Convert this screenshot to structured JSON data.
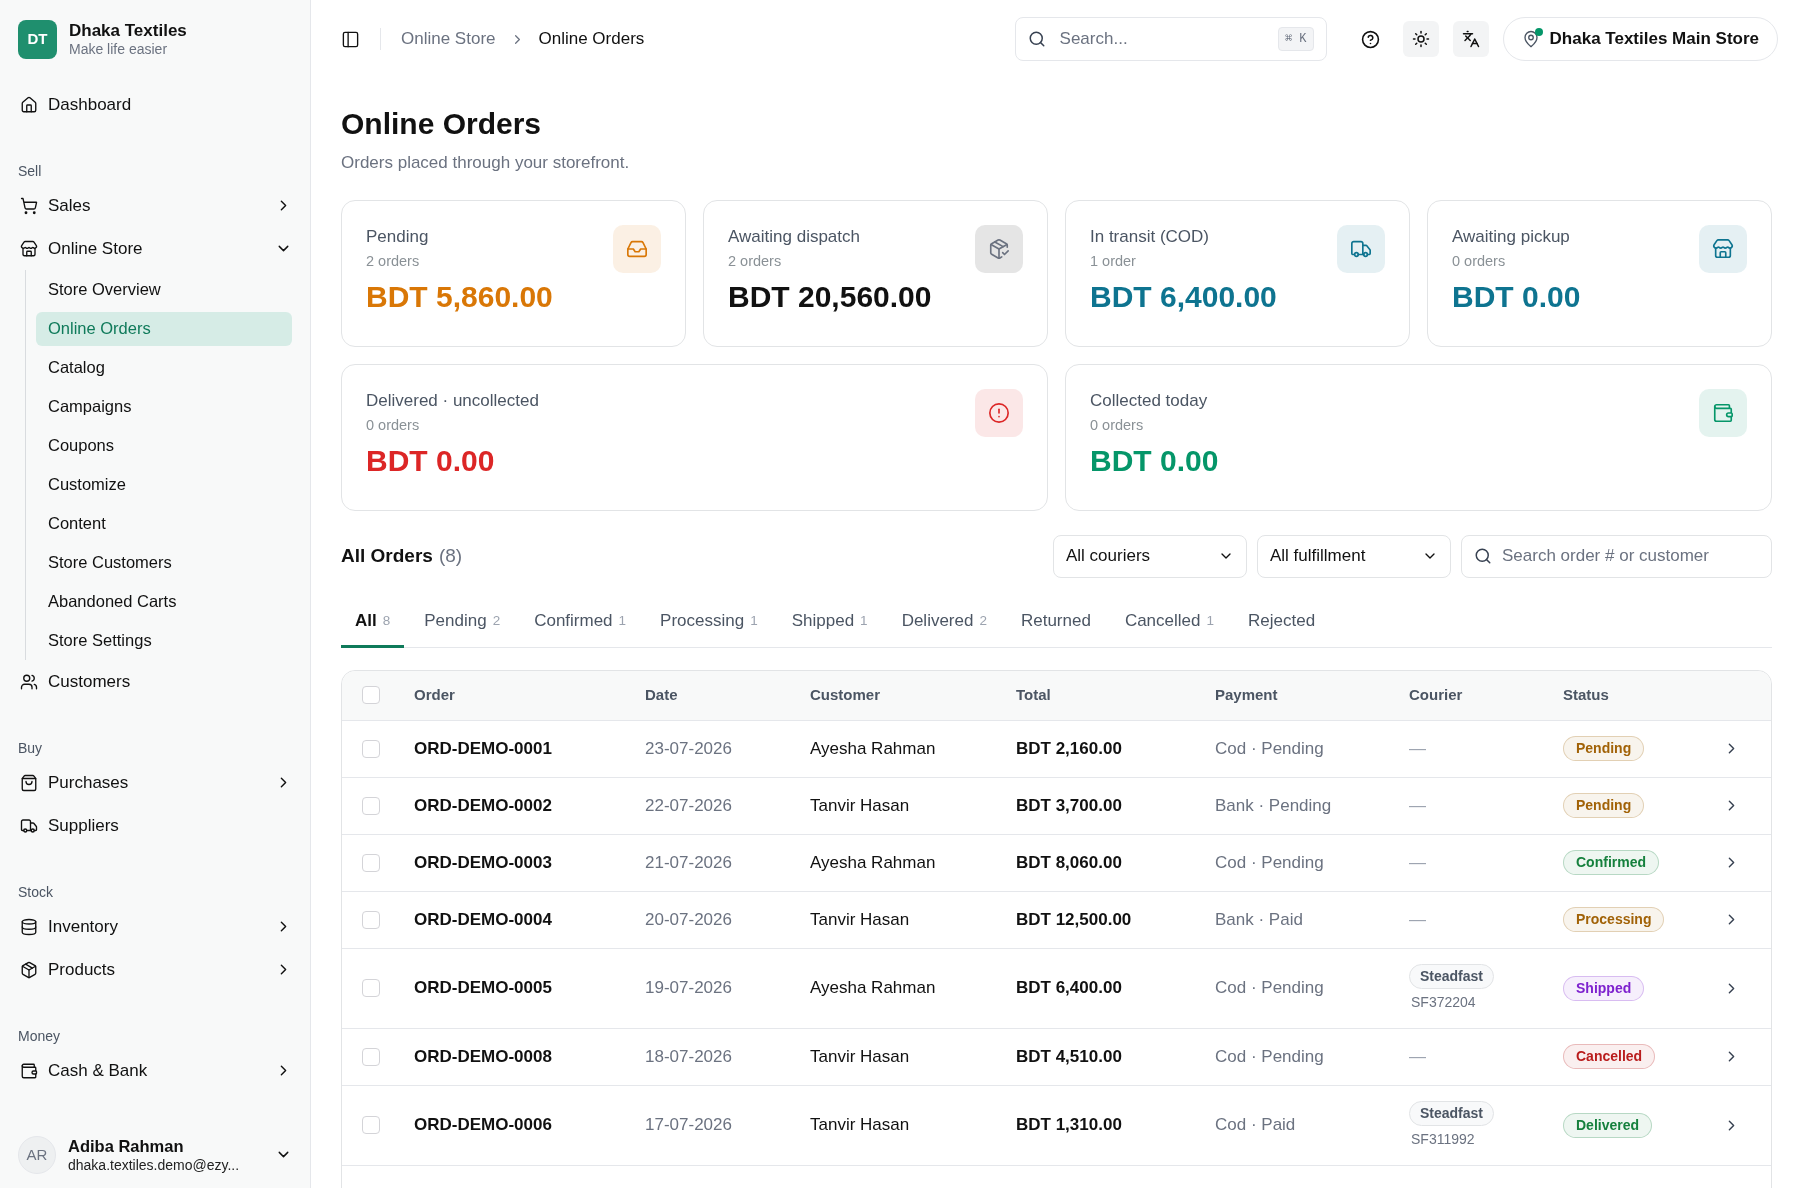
{
  "sidebar": {
    "brand": {
      "initials": "DT",
      "name": "Dhaka Textiles",
      "tagline": "Make life easier"
    },
    "sections": [
      {
        "items": [
          {
            "label": "Dashboard"
          }
        ]
      },
      {
        "label": "Sell",
        "items": [
          {
            "label": "Sales",
            "expanded": false
          },
          {
            "label": "Online Store",
            "expanded": true,
            "children": [
              {
                "label": "Store Overview",
                "selected": false
              },
              {
                "label": "Online Orders",
                "selected": true
              },
              {
                "label": "Catalog",
                "selected": false
              },
              {
                "label": "Campaigns",
                "selected": false
              },
              {
                "label": "Coupons",
                "selected": false
              },
              {
                "label": "Customize",
                "selected": false
              },
              {
                "label": "Content",
                "selected": false
              },
              {
                "label": "Store Customers",
                "selected": false
              },
              {
                "label": "Abandoned Carts",
                "selected": false
              },
              {
                "label": "Store Settings",
                "selected": false
              }
            ]
          },
          {
            "label": "Customers"
          }
        ]
      },
      {
        "label": "Buy",
        "items": [
          {
            "label": "Purchases",
            "expanded": false
          },
          {
            "label": "Suppliers"
          }
        ]
      },
      {
        "label": "Stock",
        "items": [
          {
            "label": "Inventory",
            "expanded": false
          },
          {
            "label": "Products",
            "expanded": false
          }
        ]
      },
      {
        "label": "Money",
        "items": [
          {
            "label": "Cash & Bank",
            "expanded": false
          }
        ]
      }
    ],
    "user": {
      "initials": "AR",
      "name": "Adiba Rahman",
      "email": "dhaka.textiles.demo@ezy..."
    }
  },
  "topbar": {
    "breadcrumb": [
      "Online Store",
      "Online Orders"
    ],
    "search": {
      "placeholder": "Search...",
      "shortcut": "⌘ K"
    },
    "store": {
      "label": "Dhaka Textiles Main Store",
      "color": "#059669"
    }
  },
  "page": {
    "title": "Online Orders",
    "subtitle": "Orders placed through your storefront."
  },
  "card_rows": [
    [
      {
        "label": "Pending",
        "count": "2 orders",
        "amount": "BDT 5,860.00",
        "color": "#d97706"
      },
      {
        "label": "Awaiting dispatch",
        "count": "2 orders",
        "amount": "BDT 20,560.00",
        "color": "#111111"
      },
      {
        "label": "In transit (COD)",
        "count": "1 order",
        "amount": "BDT 6,400.00",
        "color": "#0e7490"
      },
      {
        "label": "Awaiting pickup",
        "count": "0 orders",
        "amount": "BDT 0.00",
        "color": "#0e7490"
      }
    ],
    [
      {
        "label": "Delivered · uncollected",
        "count": "0 orders",
        "amount": "BDT 0.00",
        "color": "#dc2626"
      },
      {
        "label": "Collected today",
        "count": "0 orders",
        "amount": "BDT 0.00",
        "color": "#059669"
      }
    ]
  ],
  "orders": {
    "title": "All Orders",
    "count": "(8)",
    "filters": [
      "All couriers",
      "All fulfillment"
    ],
    "search": {
      "placeholder": "Search order # or customer"
    },
    "tabs": [
      {
        "label": "All",
        "count": "8",
        "selected": true
      },
      {
        "label": "Pending",
        "count": "2",
        "selected": false
      },
      {
        "label": "Confirmed",
        "count": "1",
        "selected": false
      },
      {
        "label": "Processing",
        "count": "1",
        "selected": false
      },
      {
        "label": "Shipped",
        "count": "1",
        "selected": false
      },
      {
        "label": "Delivered",
        "count": "2",
        "selected": false
      },
      {
        "label": "Returned",
        "selected": false
      },
      {
        "label": "Cancelled",
        "count": "1",
        "selected": false
      },
      {
        "label": "Rejected",
        "selected": false
      }
    ],
    "table": {
      "all_checked": false,
      "columns": [
        "Order",
        "Date",
        "Customer",
        "Total",
        "Payment",
        "Courier",
        "Status"
      ],
      "rows": [
        {
          "checked": false,
          "order": "ORD-DEMO-0001",
          "date": "23-07-2026",
          "customer": "Ayesha Rahman",
          "total": "BDT 2,160.00",
          "payment": "Cod · Pending",
          "courier": "—",
          "status": "Pending",
          "color": "#a16207"
        },
        {
          "checked": false,
          "order": "ORD-DEMO-0002",
          "date": "22-07-2026",
          "customer": "Tanvir Hasan",
          "total": "BDT 3,700.00",
          "payment": "Bank · Pending",
          "courier": "—",
          "status": "Pending",
          "color": "#a16207"
        },
        {
          "checked": false,
          "order": "ORD-DEMO-0003",
          "date": "21-07-2026",
          "customer": "Ayesha Rahman",
          "total": "BDT 8,060.00",
          "payment": "Cod · Pending",
          "courier": "—",
          "status": "Confirmed",
          "color": "#15803d"
        },
        {
          "checked": false,
          "order": "ORD-DEMO-0004",
          "date": "20-07-2026",
          "customer": "Tanvir Hasan",
          "total": "BDT 12,500.00",
          "payment": "Bank · Paid",
          "courier": "—",
          "status": "Processing",
          "color": "#a16207"
        },
        {
          "checked": false,
          "order": "ORD-DEMO-0005",
          "date": "19-07-2026",
          "customer": "Ayesha Rahman",
          "total": "BDT 6,400.00",
          "payment": "Cod · Pending",
          "courier": "Steadfast",
          "tracking": "SF372204",
          "status": "Shipped",
          "color": "#7e22ce"
        },
        {
          "checked": false,
          "order": "ORD-DEMO-0008",
          "date": "18-07-2026",
          "customer": "Tanvir Hasan",
          "total": "BDT 4,510.00",
          "payment": "Cod · Pending",
          "courier": "—",
          "status": "Cancelled",
          "color": "#b91c1c"
        },
        {
          "checked": false,
          "order": "ORD-DEMO-0006",
          "date": "17-07-2026",
          "customer": "Tanvir Hasan",
          "total": "BDT 1,310.00",
          "payment": "Cod · Paid",
          "courier": "Steadfast",
          "tracking": "SF311992",
          "status": "Delivered",
          "color": "#15803d"
        }
      ]
    }
  }
}
